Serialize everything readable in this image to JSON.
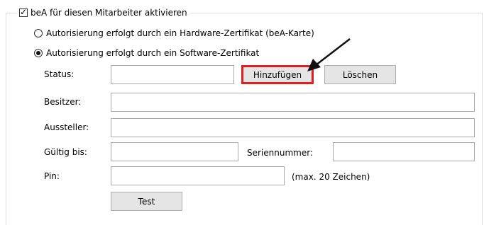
{
  "group": {
    "checkbox_label": "beA für diesen Mitarbeiter aktivieren",
    "checkbox_checked": true
  },
  "auth_options": [
    {
      "label": "Autorisierung erfolgt durch ein Hardware-Zertifikat (beA-Karte)",
      "selected": false
    },
    {
      "label": "Autorisierung erfolgt durch ein Software-Zertifikat",
      "selected": true
    }
  ],
  "form": {
    "status_label": "Status:",
    "status_value": "",
    "add_label": "Hinzufügen",
    "delete_label": "Löschen",
    "owner_label": "Besitzer:",
    "owner_value": "",
    "issuer_label": "Aussteller:",
    "issuer_value": "",
    "valid_until_label": "Gültig bis:",
    "valid_until_value": "",
    "serial_label": "Seriennummer:",
    "serial_value": "",
    "pin_label": "Pin:",
    "pin_value": "",
    "pin_hint": "(max. 20 Zeichen)",
    "test_label": "Test"
  },
  "colors": {
    "highlight": "#e02020"
  }
}
